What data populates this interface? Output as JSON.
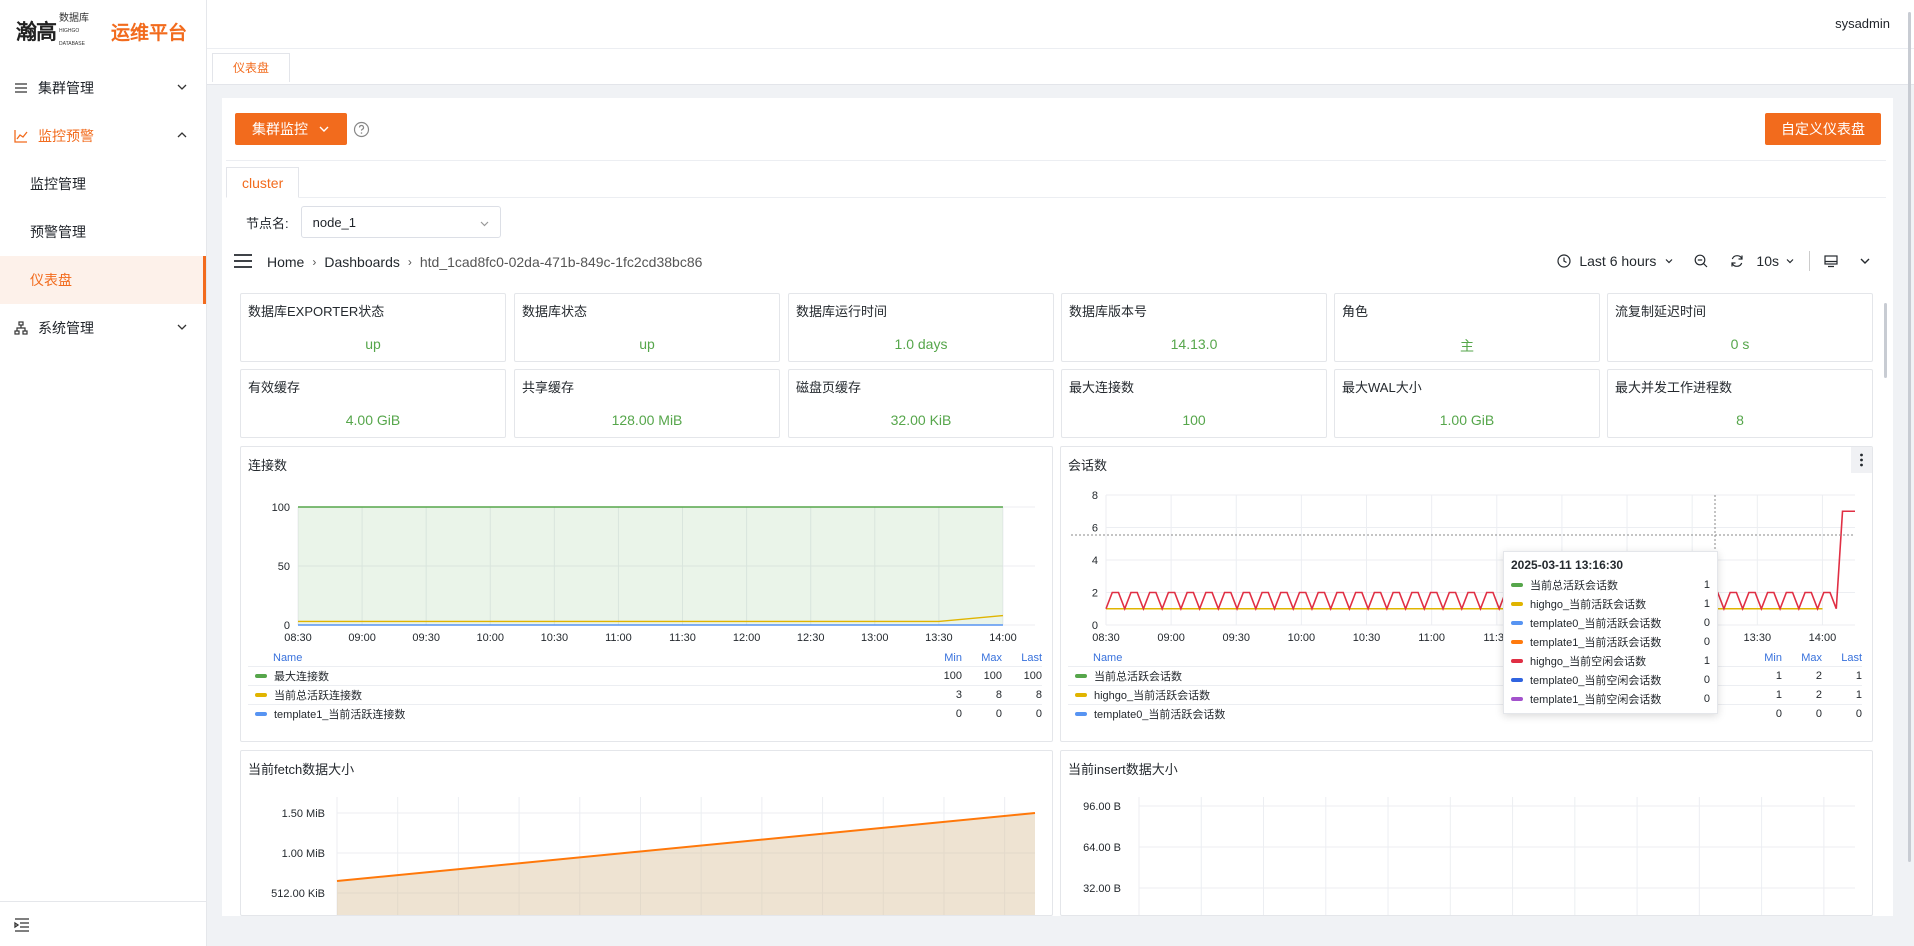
{
  "app": {
    "logo_brand": "瀚高",
    "logo_sub": "数据库",
    "logo_sub2": "HIGHGO DATABASE",
    "platform": "运维平台",
    "accent": "#f26b1d"
  },
  "sidebar": {
    "items": [
      {
        "label": "集群管理",
        "icon": "list-icon"
      },
      {
        "label": "监控预警",
        "icon": "chart-line-icon"
      },
      {
        "label": "系统管理",
        "icon": "org-chart-icon"
      }
    ],
    "sub_items": [
      "监控管理",
      "预警管理",
      "仪表盘"
    ]
  },
  "header": {
    "user": "sysadmin"
  },
  "tabs": {
    "dashboard": "仪表盘"
  },
  "main": {
    "cluster_button": "集群监控",
    "custom_button": "自定义仪表盘",
    "cluster_tab": "cluster",
    "node_label": "节点名:",
    "node_value": "node_1"
  },
  "grafana": {
    "breadcrumb": [
      "Home",
      "Dashboards",
      "htd_1cad8fc0-02da-471b-849c-1fc2cd38bc86"
    ],
    "time_range": "Last 6 hours",
    "refresh": "10s",
    "stats": [
      {
        "title": "数据库EXPORTER状态",
        "value": "up"
      },
      {
        "title": "数据库状态",
        "value": "up"
      },
      {
        "title": "数据库运行时间",
        "value": "1.0 days"
      },
      {
        "title": "数据库版本号",
        "value": "14.13.0"
      },
      {
        "title": "角色",
        "value": "主"
      },
      {
        "title": "流复制延迟时间",
        "value": "0 s"
      },
      {
        "title": "有效缓存",
        "value": "4.00 GiB"
      },
      {
        "title": "共享缓存",
        "value": "128.00 MiB"
      },
      {
        "title": "磁盘页缓存",
        "value": "32.00 KiB"
      },
      {
        "title": "最大连接数",
        "value": "100"
      },
      {
        "title": "最大WAL大小",
        "value": "1.00 GiB"
      },
      {
        "title": "最大并发工作进程数",
        "value": "8"
      }
    ],
    "legend_headers": {
      "name": "Name",
      "min": "Min",
      "max": "Max",
      "last": "Last"
    },
    "connections_panel": {
      "title": "连接数",
      "legend": [
        {
          "name": "最大连接数",
          "color": "#56a64b",
          "min": "100",
          "max": "100",
          "last": "100"
        },
        {
          "name": "当前总活跃连接数",
          "color": "#e0b400",
          "min": "3",
          "max": "8",
          "last": "8"
        },
        {
          "name": "template1_当前活跃连接数",
          "color": "#5794f2",
          "min": "0",
          "max": "0",
          "last": "0"
        }
      ]
    },
    "sessions_panel": {
      "title": "会话数",
      "legend": [
        {
          "name": "当前总活跃会话数",
          "color": "#56a64b",
          "min": "1",
          "max": "2",
          "last": "1"
        },
        {
          "name": "highgo_当前活跃会话数",
          "color": "#e0b400",
          "min": "1",
          "max": "2",
          "last": "1"
        },
        {
          "name": "template0_当前活跃会话数",
          "color": "#5794f2",
          "min": "0",
          "max": "0",
          "last": "0"
        }
      ],
      "tooltip": {
        "time": "2025-03-11 13:16:30",
        "rows": [
          {
            "name": "当前总活跃会话数",
            "value": "1",
            "color": "#56a64b"
          },
          {
            "name": "highgo_当前活跃会话数",
            "value": "1",
            "color": "#e0b400"
          },
          {
            "name": "template0_当前活跃会话数",
            "value": "0",
            "color": "#5794f2"
          },
          {
            "name": "template1_当前活跃会话数",
            "value": "0",
            "color": "#ff7a0d"
          },
          {
            "name": "highgo_当前空闲会话数",
            "value": "1",
            "color": "#e02f44"
          },
          {
            "name": "template0_当前空闲会话数",
            "value": "0",
            "color": "#3064e0"
          },
          {
            "name": "template1_当前空闲会话数",
            "value": "0",
            "color": "#a352cc"
          }
        ]
      }
    },
    "fetch_panel": {
      "title": "当前fetch数据大小"
    },
    "insert_panel": {
      "title": "当前insert数据大小"
    }
  },
  "chart_data": [
    {
      "type": "line",
      "title": "连接数",
      "x": [
        "08:30",
        "09:00",
        "09:30",
        "10:00",
        "10:30",
        "11:00",
        "11:30",
        "12:00",
        "12:30",
        "13:00",
        "13:30",
        "14:00"
      ],
      "y_ticks": [
        0,
        50,
        100
      ],
      "ylim": [
        0,
        100
      ],
      "series": [
        {
          "name": "最大连接数",
          "color": "#56a64b",
          "values": [
            100,
            100,
            100,
            100,
            100,
            100,
            100,
            100,
            100,
            100,
            100,
            100
          ]
        },
        {
          "name": "当前总活跃连接数",
          "color": "#e0b400",
          "values": [
            3,
            3,
            3,
            3,
            3,
            3,
            3,
            3,
            3,
            3,
            3,
            8
          ]
        },
        {
          "name": "template1_当前活跃连接数",
          "color": "#5794f2",
          "values": [
            0,
            0,
            0,
            0,
            0,
            0,
            0,
            0,
            0,
            0,
            0,
            0
          ]
        }
      ]
    },
    {
      "type": "line",
      "title": "会话数",
      "x": [
        "08:30",
        "09:00",
        "09:30",
        "10:00",
        "10:30",
        "11:00",
        "11:30",
        "12:00",
        "12:30",
        "13:00",
        "13:30",
        "14:00"
      ],
      "y_ticks": [
        0,
        2,
        4,
        6,
        8
      ],
      "ylim": [
        0,
        8
      ],
      "series": [
        {
          "name": "当前总活跃会话数",
          "color": "#56a64b",
          "values": [
            1,
            1,
            1,
            1,
            1,
            1,
            1,
            1,
            1,
            1,
            1,
            1
          ]
        },
        {
          "name": "highgo_当前活跃会话数",
          "color": "#e0b400",
          "values": [
            1,
            1,
            1,
            1,
            1,
            1,
            1,
            1,
            1,
            1,
            1,
            1
          ]
        },
        {
          "name": "highgo_当前空闲会话数",
          "color": "#e02f44",
          "values": [
            2,
            1,
            2,
            1,
            2,
            1,
            2,
            1,
            2,
            1,
            2,
            7
          ]
        }
      ]
    },
    {
      "type": "area",
      "title": "当前fetch数据大小",
      "y_ticks": [
        "512.00 KiB",
        "1.00 MiB",
        "1.50 MiB"
      ],
      "series": [
        {
          "name": "fetch",
          "color": "#ff780a",
          "values": [
            0.65,
            1.5
          ]
        }
      ]
    },
    {
      "type": "line",
      "title": "当前insert数据大小",
      "y_ticks": [
        "32.00 B",
        "64.00 B",
        "96.00 B"
      ],
      "series": []
    }
  ]
}
